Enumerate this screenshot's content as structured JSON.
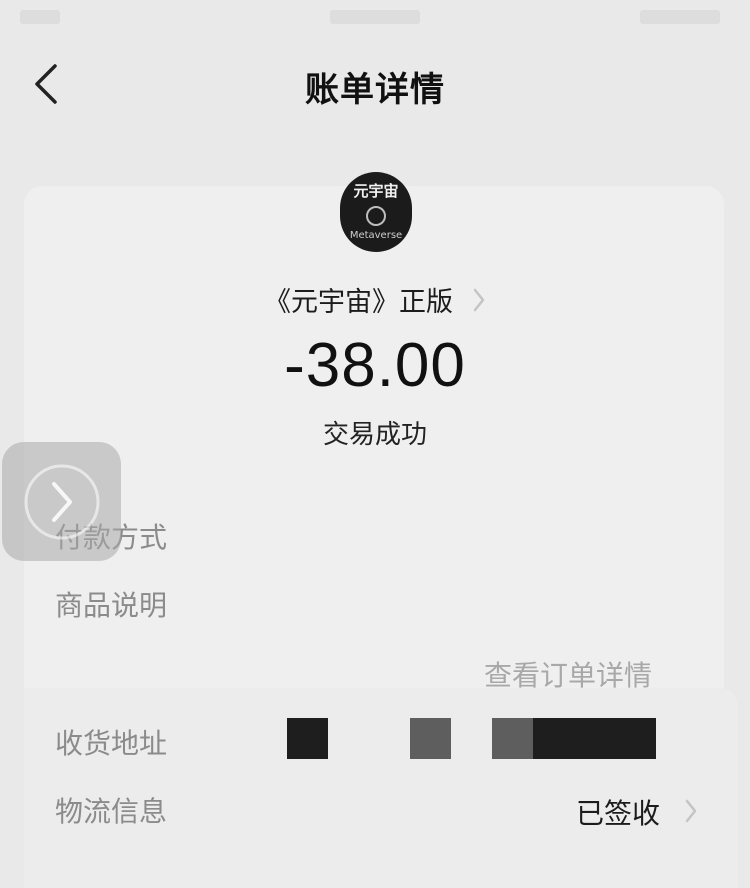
{
  "header": {
    "title": "账单详情"
  },
  "product": {
    "cover_title": "元宇宙",
    "cover_subtitle": "Metaverse",
    "name": "《元宇宙》正版"
  },
  "transaction": {
    "amount": "-38.00",
    "status": "交易成功"
  },
  "rows": {
    "payment_method_label": "付款方式",
    "product_desc_label": "商品说明",
    "order_detail_link": "查看订单详情",
    "shipping_address_label": "收货地址",
    "logistics_label": "物流信息",
    "logistics_value": "已签收"
  },
  "icons": {
    "back": "chevron-left-icon",
    "forward": "chevron-right-icon"
  },
  "colors": {
    "background": "#e9e9e9",
    "card": "#efefef",
    "label_gray": "#8b8b8b",
    "text_dark": "#1a1a1a"
  }
}
